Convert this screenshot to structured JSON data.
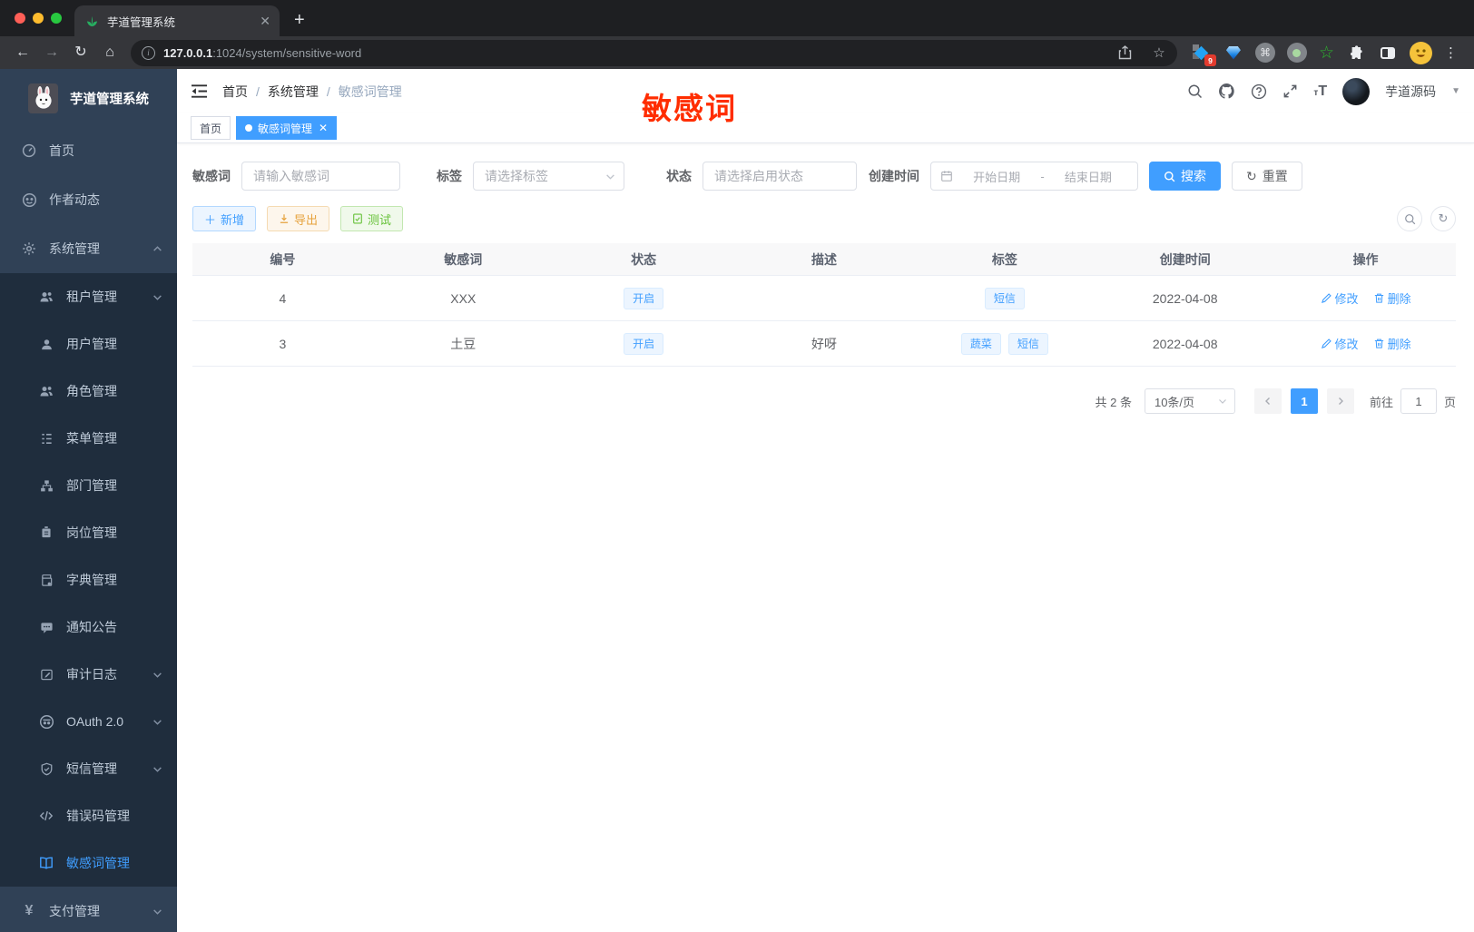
{
  "browser": {
    "tab_title": "芋道管理系统",
    "url_host": "127.0.0.1",
    "url_rest": ":1024/system/sensitive-word",
    "extension_badge": "9"
  },
  "colors": {
    "primary": "#409EFF",
    "warning": "#E6A23C",
    "success": "#67C23A",
    "sidebar_bg": "#304156",
    "submenu_bg": "#1F2D3D",
    "annotation_red": "#FF2D00"
  },
  "sidebar": {
    "logo_title": "芋道管理系统",
    "items": [
      {
        "label": "首页",
        "icon": "dashboard-icon"
      },
      {
        "label": "作者动态",
        "icon": "author-icon"
      },
      {
        "label": "系统管理",
        "icon": "gear-icon",
        "expanded": true
      },
      {
        "label": "租户管理",
        "icon": "tenant-icon",
        "submenu": true,
        "has_children": true
      },
      {
        "label": "用户管理",
        "icon": "user-icon",
        "submenu": true
      },
      {
        "label": "角色管理",
        "icon": "role-icon",
        "submenu": true
      },
      {
        "label": "菜单管理",
        "icon": "menu-tree-icon",
        "submenu": true
      },
      {
        "label": "部门管理",
        "icon": "org-chart-icon",
        "submenu": true
      },
      {
        "label": "岗位管理",
        "icon": "post-badge-icon",
        "submenu": true
      },
      {
        "label": "字典管理",
        "icon": "dict-book-icon",
        "submenu": true
      },
      {
        "label": "通知公告",
        "icon": "notice-icon",
        "submenu": true
      },
      {
        "label": "审计日志",
        "icon": "audit-log-icon",
        "submenu": true,
        "has_children": true
      },
      {
        "label": "OAuth 2.0",
        "icon": "oauth-icon",
        "submenu": true,
        "has_children": true
      },
      {
        "label": "短信管理",
        "icon": "sms-shield-icon",
        "submenu": true,
        "has_children": true
      },
      {
        "label": "错误码管理",
        "icon": "error-code-icon",
        "submenu": true
      },
      {
        "label": "敏感词管理",
        "icon": "open-book-icon",
        "submenu": true,
        "active": true
      },
      {
        "label": "支付管理",
        "icon": "pay-yen-icon",
        "has_children": true
      }
    ]
  },
  "header": {
    "breadcrumb": [
      "首页",
      "系统管理",
      "敏感词管理"
    ],
    "username": "芋道源码"
  },
  "tabs": [
    {
      "label": "首页"
    },
    {
      "label": "敏感词管理",
      "active": true,
      "closable": true
    }
  ],
  "annotation": {
    "text": "敏感词"
  },
  "filters": {
    "keyword_label": "敏感词",
    "keyword_placeholder": "请输入敏感词",
    "tag_label": "标签",
    "tag_placeholder": "请选择标签",
    "status_label": "状态",
    "status_placeholder": "请选择启用状态",
    "date_label": "创建时间",
    "date_start_placeholder": "开始日期",
    "date_separator": "-",
    "date_end_placeholder": "结束日期",
    "search_label": "搜索",
    "reset_label": "重置"
  },
  "toolbar": {
    "add_label": "新增",
    "export_label": "导出",
    "test_label": "测试"
  },
  "table": {
    "headers": [
      "编号",
      "敏感词",
      "状态",
      "描述",
      "标签",
      "创建时间",
      "操作"
    ],
    "rows": [
      {
        "id": "4",
        "word": "XXX",
        "status": "开启",
        "description": "",
        "tags": [
          "短信"
        ],
        "created": "2022-04-08",
        "edit": "修改",
        "delete": "删除"
      },
      {
        "id": "3",
        "word": "土豆",
        "status": "开启",
        "description": "好呀",
        "tags": [
          "蔬菜",
          "短信"
        ],
        "created": "2022-04-08",
        "edit": "修改",
        "delete": "删除"
      }
    ]
  },
  "pagination": {
    "total": "共 2 条",
    "page_size": "10条/页",
    "current_page": "1",
    "goto_label": "前往",
    "goto_value": "1",
    "page_unit": "页"
  }
}
